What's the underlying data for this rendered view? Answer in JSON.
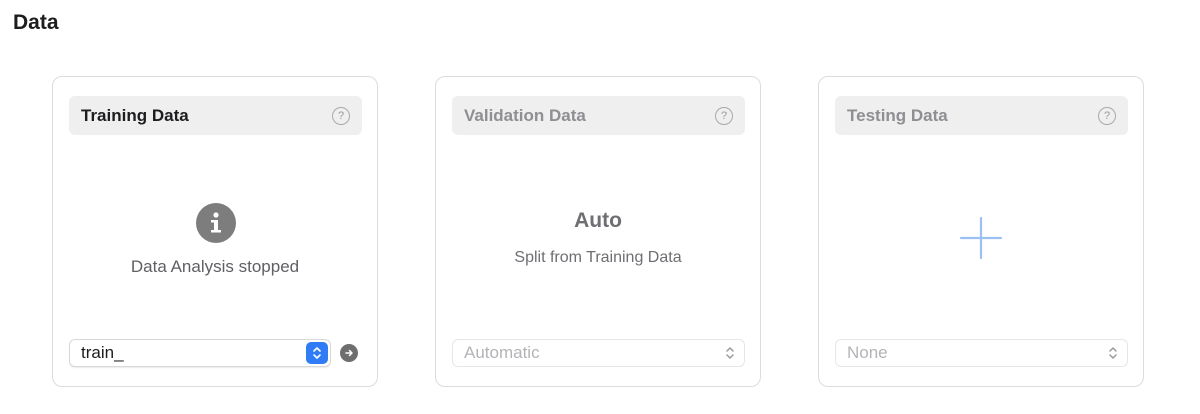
{
  "section": {
    "title": "Data"
  },
  "training": {
    "title": "Training Data",
    "help": "?",
    "status": "Data Analysis stopped",
    "select_value": "train_",
    "icon": "info-icon"
  },
  "validation": {
    "title": "Validation Data",
    "help": "?",
    "heading": "Auto",
    "subtext": "Split from Training Data",
    "select_value": "Automatic"
  },
  "testing": {
    "title": "Testing Data",
    "help": "?",
    "icon": "plus-icon",
    "select_value": "None"
  },
  "colors": {
    "accent": "#2f7cf6",
    "plus": "#9cc0f3",
    "card_border": "#dcdcdc",
    "header_bg": "#efefef"
  }
}
